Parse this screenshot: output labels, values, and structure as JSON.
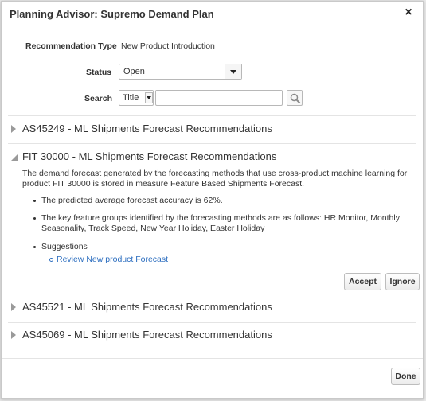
{
  "dialog": {
    "title": "Planning Advisor: Supremo Demand Plan",
    "close_glyph": "×"
  },
  "form": {
    "recommendation_type_label": "Recommendation Type",
    "recommendation_type_value": "New Product Introduction",
    "status_label": "Status",
    "status_value": "Open",
    "search_label": "Search",
    "search_field_value": "Title",
    "search_text": ""
  },
  "sections": [
    {
      "title": "AS45249 - ML Shipments Forecast Recommendations",
      "expanded": false
    },
    {
      "title": "FIT 30000 - ML Shipments Forecast Recommendations",
      "expanded": true,
      "description_line1": "The demand forecast generated by the forecasting methods that use cross-product machine learning for",
      "description_line2": "product FIT 30000 is stored in measure Feature Based Shipments Forecast.",
      "bullet_accuracy": "The predicted average forecast accuracy is 62%.",
      "bullet_features_line1": "The key feature groups identified by the forecasting methods are as follows: HR Monitor, Monthly",
      "bullet_features_line2": "Seasonality, Track Speed, New Year Holiday, Easter Holiday",
      "bullet_suggestions": "Suggestions",
      "suggestion_link": "Review New product Forecast",
      "accept_label": "Accept",
      "ignore_label": "Ignore"
    },
    {
      "title": "AS45521 - ML Shipments Forecast Recommendations",
      "expanded": false
    },
    {
      "title": "AS45069 - ML Shipments Forecast Recommendations",
      "expanded": false
    }
  ],
  "footer": {
    "done_label": "Done"
  },
  "icons": {
    "close": "close-icon",
    "dropdown": "chevron-down-icon",
    "search": "search-icon",
    "collapsed": "triangle-right-icon",
    "expanded": "triangle-open-icon"
  },
  "colors": {
    "link": "#2b6dbf",
    "focus": "#3b73c9"
  }
}
